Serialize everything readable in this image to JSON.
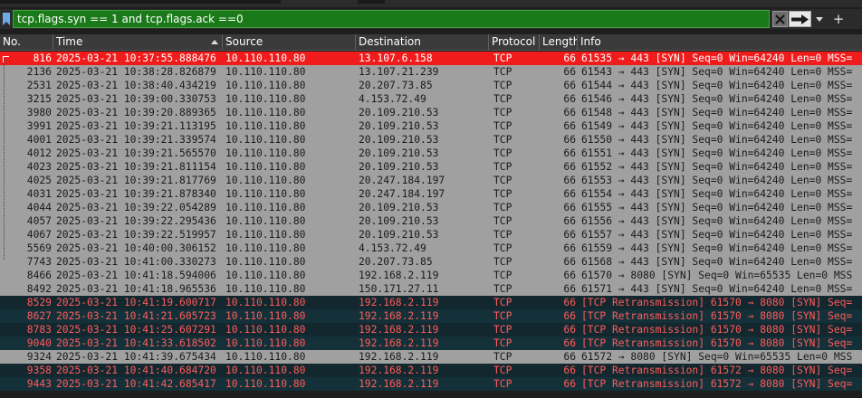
{
  "filter": {
    "expression": "tcp.flags.syn == 1 and tcp.flags.ack ==0",
    "add_label": "+"
  },
  "colors": {
    "filter_valid_bg": "#1a7a1a",
    "selected_row": "#f01c1c",
    "normal_row": "#a0a0a0",
    "retransmission_row_bg": "#12272e",
    "retransmission_text": "#ff5c5c"
  },
  "icons": {
    "bookmark": "bookmark-icon",
    "clear": "clear-x-icon",
    "apply": "arrow-right-icon",
    "dropdown": "chevron-down-icon",
    "add": "plus-icon",
    "sort": "sort-ascending-icon"
  },
  "columns": [
    "No.",
    "Time",
    "Source",
    "Destination",
    "Protocol",
    "Length",
    "Info"
  ],
  "packets": [
    {
      "no": "816",
      "time": "2025-03-21 10:37:55.888476",
      "src": "10.110.110.80",
      "dst": "13.107.6.158",
      "proto": "TCP",
      "len": "66",
      "info": "61535 → 443 [SYN] Seq=0 Win=64240 Len=0 MSS=",
      "style": "selected"
    },
    {
      "no": "2136",
      "time": "2025-03-21 10:38:28.826879",
      "src": "10.110.110.80",
      "dst": "13.107.21.239",
      "proto": "TCP",
      "len": "66",
      "info": "61543 → 443 [SYN] Seq=0 Win=64240 Len=0 MSS=",
      "style": "gray"
    },
    {
      "no": "2531",
      "time": "2025-03-21 10:38:40.434219",
      "src": "10.110.110.80",
      "dst": "20.207.73.85",
      "proto": "TCP",
      "len": "66",
      "info": "61544 → 443 [SYN] Seq=0 Win=64240 Len=0 MSS=",
      "style": "gray"
    },
    {
      "no": "3215",
      "time": "2025-03-21 10:39:00.330753",
      "src": "10.110.110.80",
      "dst": "4.153.72.49",
      "proto": "TCP",
      "len": "66",
      "info": "61546 → 443 [SYN] Seq=0 Win=64240 Len=0 MSS=",
      "style": "gray"
    },
    {
      "no": "3980",
      "time": "2025-03-21 10:39:20.889365",
      "src": "10.110.110.80",
      "dst": "20.109.210.53",
      "proto": "TCP",
      "len": "66",
      "info": "61548 → 443 [SYN] Seq=0 Win=64240 Len=0 MSS=",
      "style": "gray"
    },
    {
      "no": "3991",
      "time": "2025-03-21 10:39:21.113195",
      "src": "10.110.110.80",
      "dst": "20.109.210.53",
      "proto": "TCP",
      "len": "66",
      "info": "61549 → 443 [SYN] Seq=0 Win=64240 Len=0 MSS=",
      "style": "gray"
    },
    {
      "no": "4001",
      "time": "2025-03-21 10:39:21.339574",
      "src": "10.110.110.80",
      "dst": "20.109.210.53",
      "proto": "TCP",
      "len": "66",
      "info": "61550 → 443 [SYN] Seq=0 Win=64240 Len=0 MSS=",
      "style": "gray"
    },
    {
      "no": "4012",
      "time": "2025-03-21 10:39:21.565570",
      "src": "10.110.110.80",
      "dst": "20.109.210.53",
      "proto": "TCP",
      "len": "66",
      "info": "61551 → 443 [SYN] Seq=0 Win=64240 Len=0 MSS=",
      "style": "gray"
    },
    {
      "no": "4023",
      "time": "2025-03-21 10:39:21.811154",
      "src": "10.110.110.80",
      "dst": "20.109.210.53",
      "proto": "TCP",
      "len": "66",
      "info": "61552 → 443 [SYN] Seq=0 Win=64240 Len=0 MSS=",
      "style": "gray"
    },
    {
      "no": "4025",
      "time": "2025-03-21 10:39:21.817769",
      "src": "10.110.110.80",
      "dst": "20.247.184.197",
      "proto": "TCP",
      "len": "66",
      "info": "61553 → 443 [SYN] Seq=0 Win=64240 Len=0 MSS=",
      "style": "gray"
    },
    {
      "no": "4031",
      "time": "2025-03-21 10:39:21.878340",
      "src": "10.110.110.80",
      "dst": "20.247.184.197",
      "proto": "TCP",
      "len": "66",
      "info": "61554 → 443 [SYN] Seq=0 Win=64240 Len=0 MSS=",
      "style": "gray"
    },
    {
      "no": "4044",
      "time": "2025-03-21 10:39:22.054289",
      "src": "10.110.110.80",
      "dst": "20.109.210.53",
      "proto": "TCP",
      "len": "66",
      "info": "61555 → 443 [SYN] Seq=0 Win=64240 Len=0 MSS=",
      "style": "gray"
    },
    {
      "no": "4057",
      "time": "2025-03-21 10:39:22.295436",
      "src": "10.110.110.80",
      "dst": "20.109.210.53",
      "proto": "TCP",
      "len": "66",
      "info": "61556 → 443 [SYN] Seq=0 Win=64240 Len=0 MSS=",
      "style": "gray"
    },
    {
      "no": "4067",
      "time": "2025-03-21 10:39:22.519957",
      "src": "10.110.110.80",
      "dst": "20.109.210.53",
      "proto": "TCP",
      "len": "66",
      "info": "61557 → 443 [SYN] Seq=0 Win=64240 Len=0 MSS=",
      "style": "gray"
    },
    {
      "no": "5569",
      "time": "2025-03-21 10:40:00.306152",
      "src": "10.110.110.80",
      "dst": "4.153.72.49",
      "proto": "TCP",
      "len": "66",
      "info": "61559 → 443 [SYN] Seq=0 Win=64240 Len=0 MSS=",
      "style": "gray"
    },
    {
      "no": "7743",
      "time": "2025-03-21 10:41:00.330273",
      "src": "10.110.110.80",
      "dst": "20.207.73.85",
      "proto": "TCP",
      "len": "66",
      "info": "61568 → 443 [SYN] Seq=0 Win=64240 Len=0 MSS=",
      "style": "gray"
    },
    {
      "no": "8466",
      "time": "2025-03-21 10:41:18.594006",
      "src": "10.110.110.80",
      "dst": "192.168.2.119",
      "proto": "TCP",
      "len": "66",
      "info": "61570 → 8080 [SYN] Seq=0 Win=65535 Len=0 MSS",
      "style": "gray"
    },
    {
      "no": "8492",
      "time": "2025-03-21 10:41:18.965536",
      "src": "10.110.110.80",
      "dst": "150.171.27.11",
      "proto": "TCP",
      "len": "66",
      "info": "61571 → 443 [SYN] Seq=0 Win=64240 Len=0 MSS=",
      "style": "gray"
    },
    {
      "no": "8529",
      "time": "2025-03-21 10:41:19.600717",
      "src": "10.110.110.80",
      "dst": "192.168.2.119",
      "proto": "TCP",
      "len": "66",
      "info": "[TCP Retransmission] 61570 → 8080 [SYN] Seq=",
      "style": "retrans"
    },
    {
      "no": "8627",
      "time": "2025-03-21 10:41:21.605723",
      "src": "10.110.110.80",
      "dst": "192.168.2.119",
      "proto": "TCP",
      "len": "66",
      "info": "[TCP Retransmission] 61570 → 8080 [SYN] Seq=",
      "style": "retrans alt"
    },
    {
      "no": "8783",
      "time": "2025-03-21 10:41:25.607291",
      "src": "10.110.110.80",
      "dst": "192.168.2.119",
      "proto": "TCP",
      "len": "66",
      "info": "[TCP Retransmission] 61570 → 8080 [SYN] Seq=",
      "style": "retrans"
    },
    {
      "no": "9040",
      "time": "2025-03-21 10:41:33.618502",
      "src": "10.110.110.80",
      "dst": "192.168.2.119",
      "proto": "TCP",
      "len": "66",
      "info": "[TCP Retransmission] 61570 → 8080 [SYN] Seq=",
      "style": "retrans alt"
    },
    {
      "no": "9324",
      "time": "2025-03-21 10:41:39.675434",
      "src": "10.110.110.80",
      "dst": "192.168.2.119",
      "proto": "TCP",
      "len": "66",
      "info": "61572 → 8080 [SYN] Seq=0 Win=65535 Len=0 MSS",
      "style": "gray"
    },
    {
      "no": "9358",
      "time": "2025-03-21 10:41:40.684720",
      "src": "10.110.110.80",
      "dst": "192.168.2.119",
      "proto": "TCP",
      "len": "66",
      "info": "[TCP Retransmission] 61572 → 8080 [SYN] Seq=",
      "style": "retrans"
    },
    {
      "no": "9443",
      "time": "2025-03-21 10:41:42.685417",
      "src": "10.110.110.80",
      "dst": "192.168.2.119",
      "proto": "TCP",
      "len": "66",
      "info": "[TCP Retransmission] 61572 → 8080 [SYN] Seq=",
      "style": "retrans alt"
    }
  ]
}
